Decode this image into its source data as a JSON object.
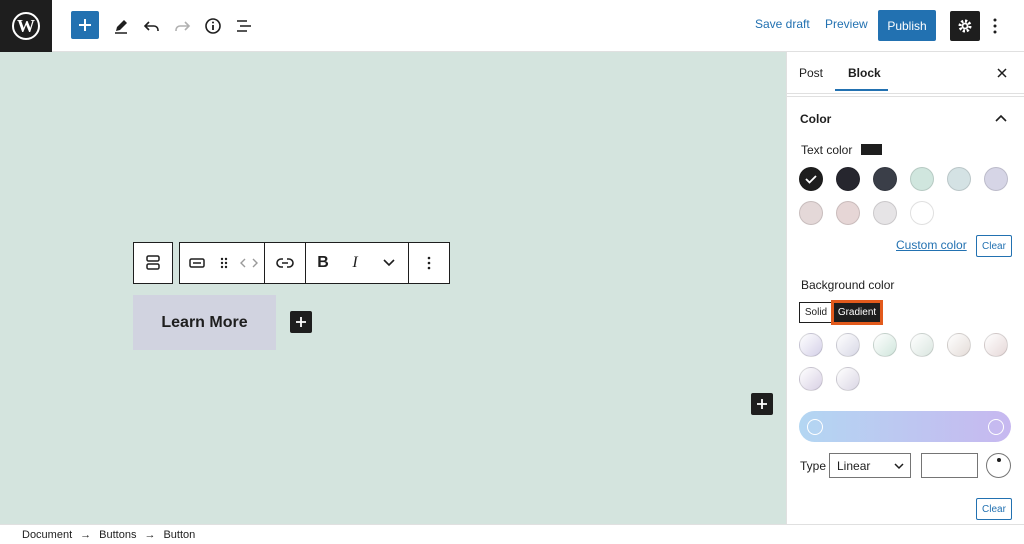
{
  "header": {
    "save_draft": "Save draft",
    "preview": "Preview",
    "publish": "Publish"
  },
  "icons": [
    "wordpress-icon",
    "plus-icon",
    "pencil-icon",
    "undo-icon",
    "redo-icon",
    "info-icon",
    "list-view-icon",
    "gear-icon",
    "more-vertical-icon"
  ],
  "canvas": {
    "button_text": "Learn More",
    "background": "#d4e4de",
    "button_background": "#d1d3e0"
  },
  "sidebar": {
    "tabs": [
      {
        "label": "Post"
      },
      {
        "label": "Block"
      }
    ],
    "section": "Color",
    "text_color_label": "Text color",
    "custom_color": "Custom color",
    "clear": "Clear",
    "background_color_label": "Background color",
    "solid": "Solid",
    "gradient": "Gradient",
    "type_label": "Type",
    "type_value": "Linear",
    "text_swatches": [
      "#1e1e1e",
      "#26262e",
      "#3a3e48",
      "#d0e6de",
      "#d4e2e4",
      "#d6d5e6",
      "#e4d8d8",
      "#e6d6d6",
      "#e6e4e6",
      "#ffffff"
    ],
    "gradient_swatches": [
      "#d4d0e8",
      "#d8d8e6",
      "#d0e6dc",
      "#dae6e0",
      "#e4dcd8",
      "#e6d8d8",
      "#d8d0e4",
      "#dad6e4"
    ]
  },
  "breadcrumb": [
    "Document",
    "Buttons",
    "Button"
  ],
  "accent": "#2271b1",
  "highlight_color": "#e25a1c"
}
